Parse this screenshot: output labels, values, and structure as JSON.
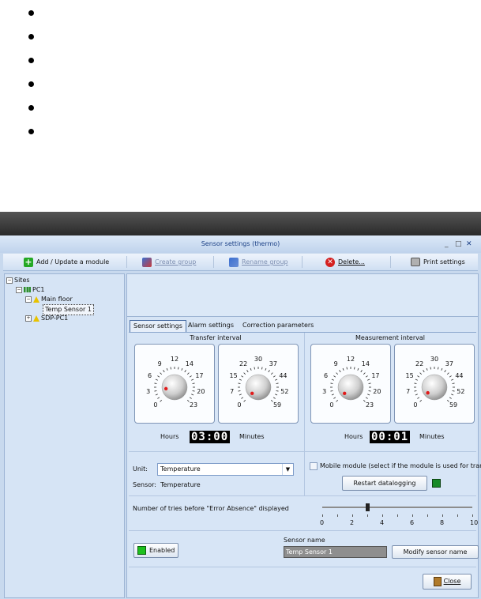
{
  "window": {
    "title": "Sensor settings (thermo)",
    "controls": [
      "_",
      "□",
      "✕"
    ]
  },
  "toolbar": {
    "add_update": "Add / Update a module",
    "create_group": "Create group",
    "rename_group": "Rename group",
    "delete": "Delete...",
    "print_settings": "Print settings"
  },
  "tree": {
    "root": "Sites",
    "pc": "PC1",
    "floor": "Main floor",
    "sensor": "Temp Sensor 1",
    "sdp": "SDP-PC1"
  },
  "tabs": [
    "Sensor settings",
    "Alarm settings",
    "Correction parameters"
  ],
  "transfer": {
    "title": "Transfer interval",
    "hours_label": "Hours",
    "minutes_label": "Minutes",
    "display": "03:00",
    "hours_dial": {
      "labels": [
        "0",
        "3",
        "6",
        "9",
        "12",
        "14",
        "17",
        "20",
        "23"
      ],
      "value": 3
    },
    "minutes_dial": {
      "labels": [
        "0",
        "7",
        "15",
        "22",
        "30",
        "37",
        "44",
        "52",
        "59"
      ],
      "value": 0
    }
  },
  "measurement": {
    "title": "Measurement interval",
    "hours_label": "Hours",
    "minutes_label": "Minutes",
    "display": "00:01",
    "hours_dial": {
      "labels": [
        "0",
        "3",
        "6",
        "9",
        "12",
        "14",
        "17",
        "20",
        "23"
      ],
      "value": 0
    },
    "minutes_dial": {
      "labels": [
        "0",
        "7",
        "15",
        "22",
        "30",
        "37",
        "44",
        "52",
        "59"
      ],
      "value": 1
    }
  },
  "unit": {
    "label": "Unit:",
    "value": "Temperature",
    "sensor_label": "Sensor:",
    "sensor_value": "Temperature"
  },
  "mobile": {
    "checked": false,
    "label": "Mobile module  (select if the module is used for transp."
  },
  "restart_label": "Restart datalogging",
  "tries": {
    "label": "Number of tries before \"Error Absence\" displayed",
    "scale": [
      "0",
      "2",
      "4",
      "6",
      "8",
      "10"
    ],
    "value": 3
  },
  "enabled_label": "Enabled",
  "sensor_name": {
    "label": "Sensor name",
    "value": "Temp Sensor 1",
    "modify_label": "Modify sensor name"
  },
  "close_label": "Close",
  "colors": {
    "accent": "#1a3f85",
    "led_green": "#168a26",
    "enabled_green": "#1ec01e",
    "dial_dot": "#e21b1b"
  }
}
